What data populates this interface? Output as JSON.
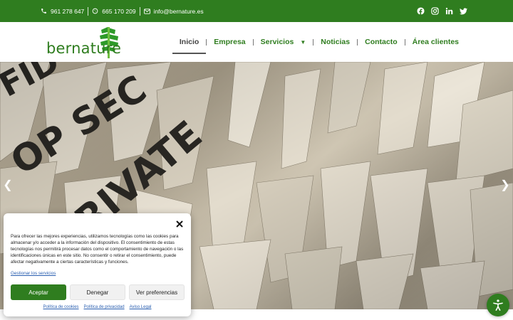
{
  "topbar": {
    "phone1": "961 278 647",
    "phone2": "665 170 209",
    "email": "info@bernature.es",
    "socials": [
      "facebook-icon",
      "instagram-icon",
      "linkedin-icon",
      "twitter-icon"
    ]
  },
  "logo": {
    "text": "bernature"
  },
  "nav": {
    "items": [
      {
        "label": "Inicio",
        "active": true
      },
      {
        "label": "Empresa"
      },
      {
        "label": "Servicios",
        "dropdown": true
      },
      {
        "label": "Noticias"
      },
      {
        "label": "Contacto"
      },
      {
        "label": "Área clientes"
      }
    ]
  },
  "hero": {
    "prev_icon": "chevron-left-icon",
    "next_icon": "chevron-right-icon"
  },
  "cookie": {
    "text": "Para ofrecer las mejores experiencias, utilizamos tecnologías como las cookies para almacenar y/o acceder a la información del dispositivo. El consentimiento de estas tecnologías nos permitirá procesar datos como el comportamiento de navegación o las identificaciones únicas en este sitio. No consentir o retirar el consentimiento, puede afectar negativamente a ciertas características y funciones.",
    "manage_link": "Gestionar los servicios",
    "accept": "Aceptar",
    "deny": "Denegar",
    "preferences": "Ver preferencias",
    "footer_links": [
      "Política de cookies",
      "Política de privacidad",
      "Aviso Legal"
    ]
  },
  "colors": {
    "brand_green": "#2f7d1f",
    "link_blue": "#2a5fb0"
  }
}
